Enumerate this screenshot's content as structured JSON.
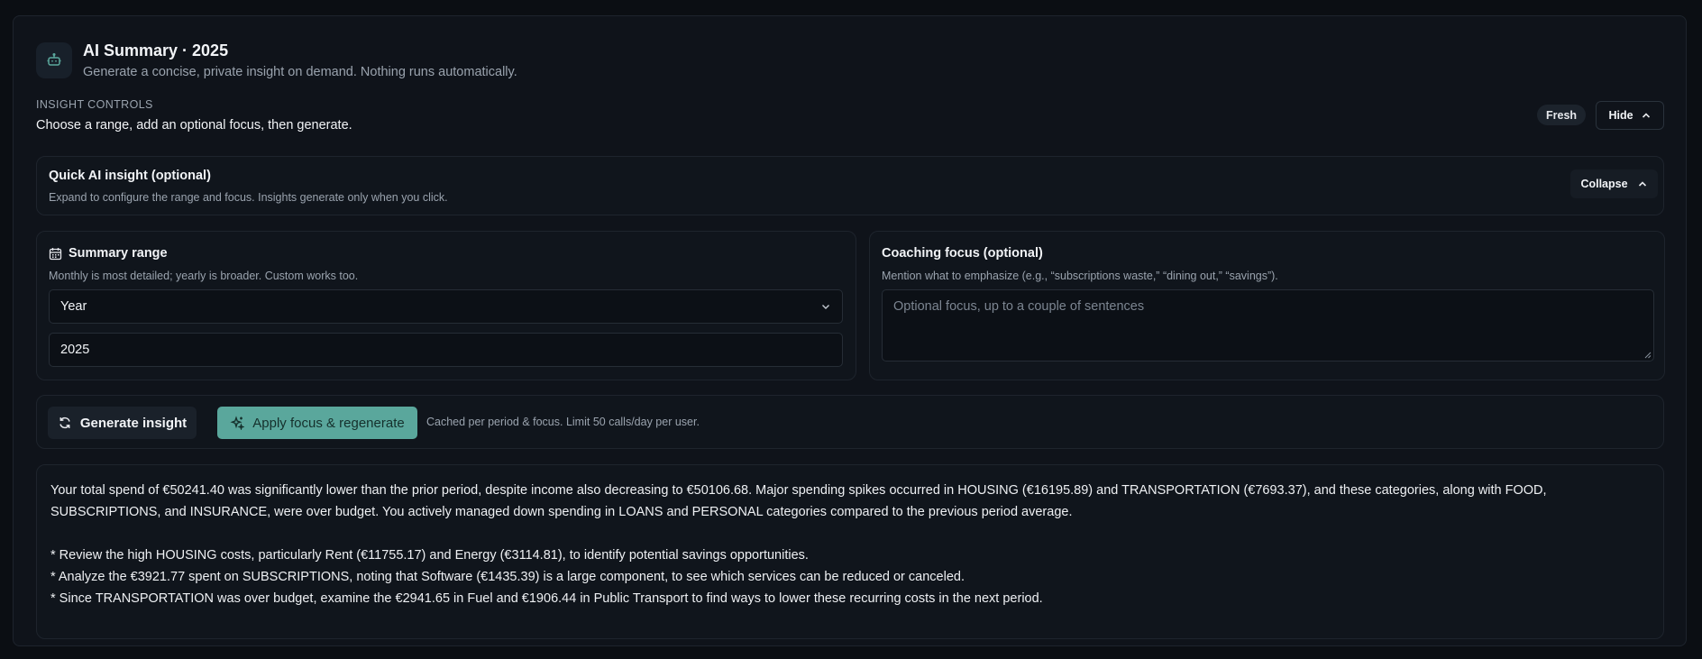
{
  "header": {
    "icon": "robot-icon",
    "title": "AI Summary · 2025",
    "subtitle": "Generate a concise, private insight on demand. Nothing runs automatically."
  },
  "controls": {
    "label": "INSIGHT CONTROLS",
    "instruction": "Choose a range, add an optional focus, then generate.",
    "badge": "Fresh",
    "hide_label": "Hide"
  },
  "quick": {
    "title": "Quick AI insight (optional)",
    "description": "Expand to configure the range and focus. Insights generate only when you click.",
    "collapse_label": "Collapse"
  },
  "range": {
    "icon": "calendar-icon",
    "title": "Summary range",
    "description": "Monthly is most detailed; yearly is broader. Custom works too.",
    "selected": "Year",
    "year_value": "2025"
  },
  "coaching": {
    "title": "Coaching focus (optional)",
    "description": "Mention what to emphasize (e.g., “subscriptions waste,” “dining out,” “savings”).",
    "placeholder": "Optional focus, up to a couple of sentences",
    "value": ""
  },
  "actions": {
    "generate_label": "Generate insight",
    "apply_label": "Apply focus & regenerate",
    "note": "Cached per period & focus. Limit 50 calls/day per user.",
    "accent_color": "#5aa79c"
  },
  "output": {
    "summary_line1": "Your total spend of €50241.40 was significantly lower than the prior period, despite income also decreasing to €50106.68. Major spending spikes occurred in HOUSING (€16195.89) and TRANSPORTATION (€7693.37), and these categories, along with FOOD,",
    "summary_line2": "SUBSCRIPTIONS, and INSURANCE, were over budget. You actively managed down spending in LOANS and PERSONAL categories compared to the previous period average.",
    "bullets": [
      "* Review the high HOUSING costs, particularly Rent (€11755.17) and Energy (€3114.81), to identify potential savings opportunities.",
      "* Analyze the €3921.77 spent on SUBSCRIPTIONS, noting that Software (€1435.39) is a large component, to see which services can be reduced or canceled.",
      "* Since TRANSPORTATION was over budget, examine the €2941.65 in Fuel and €1906.44 in Public Transport to find ways to lower these recurring costs in the next period."
    ]
  }
}
